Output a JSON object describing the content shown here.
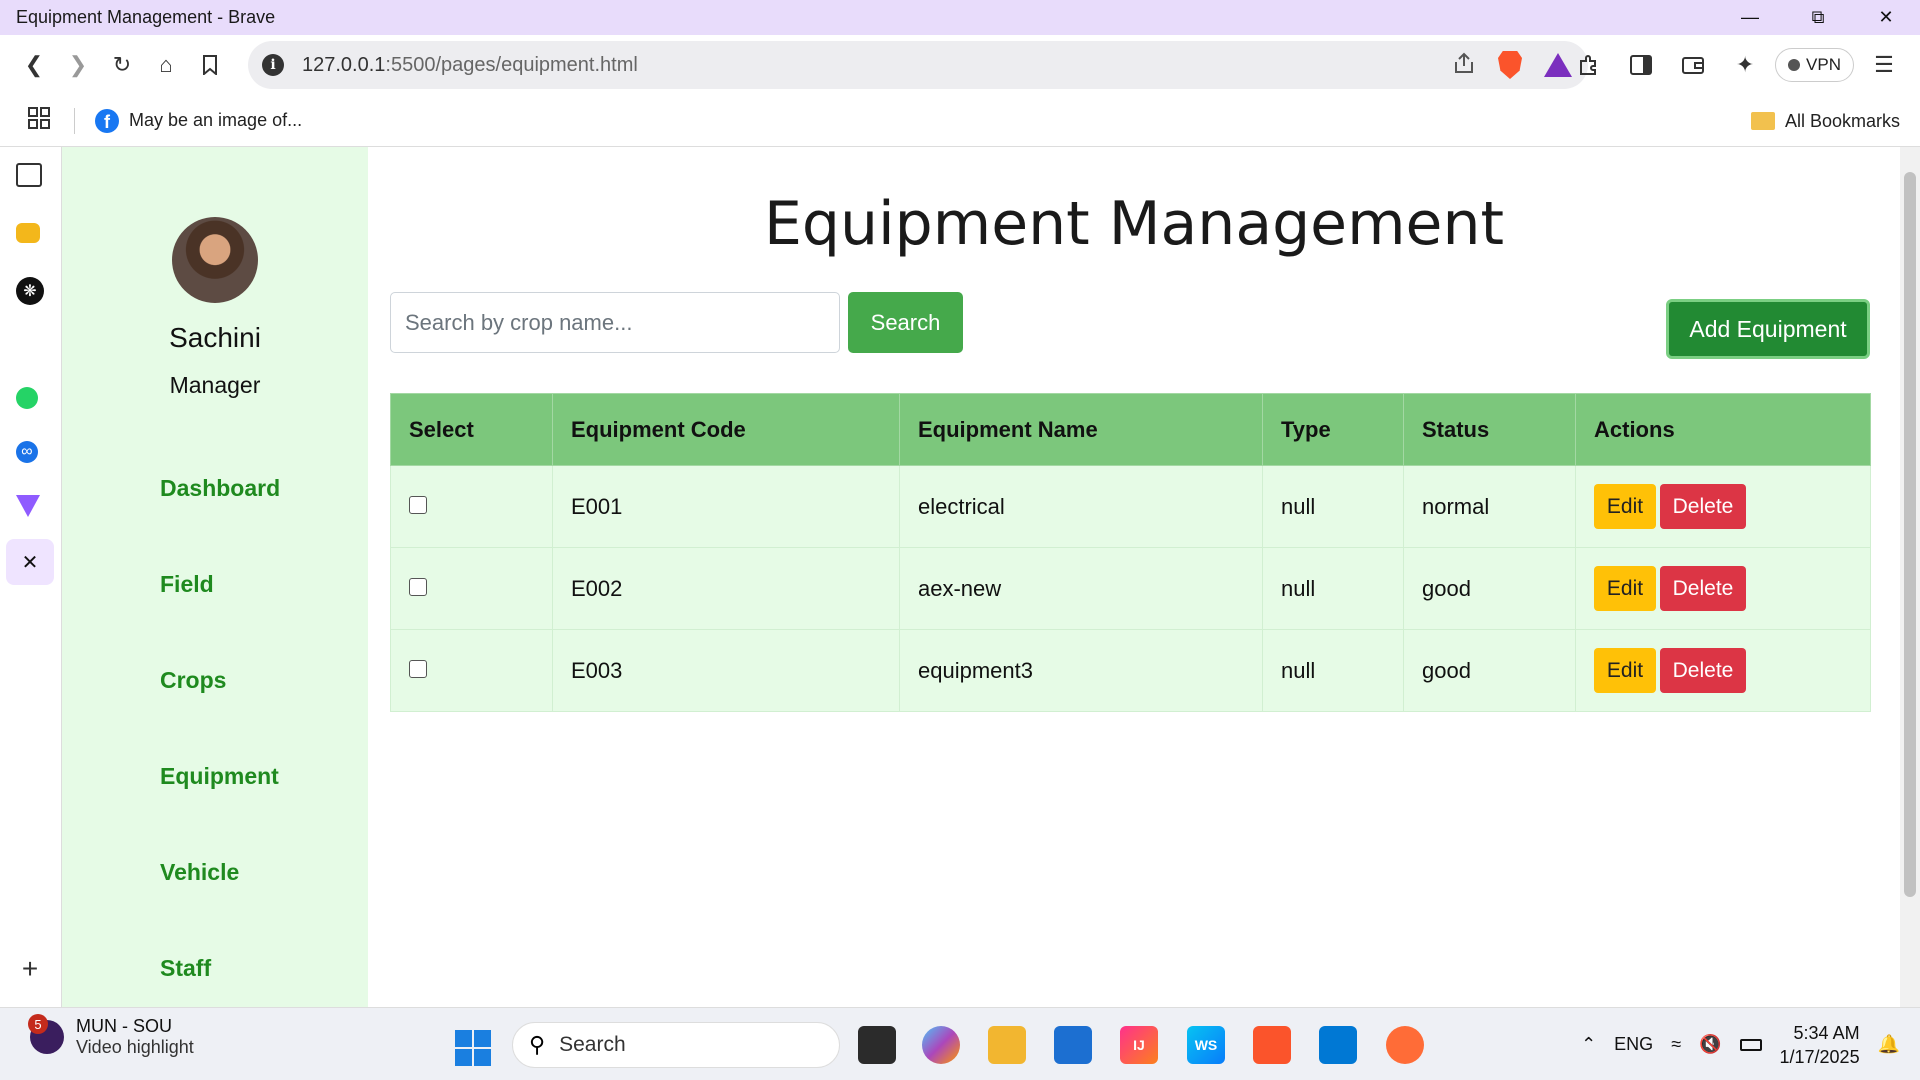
{
  "window": {
    "title": "Equipment Management - Brave"
  },
  "browser": {
    "url_host": "127.0.0.1",
    "url_path": ":5500/pages/equipment.html",
    "vpn_label": "VPN",
    "bookmark_label": "May be an image of...",
    "all_bookmarks_label": "All Bookmarks"
  },
  "sidebar": {
    "user_name": "Sachini",
    "user_role": "Manager",
    "nav": [
      "Dashboard",
      "Field",
      "Crops",
      "Equipment",
      "Vehicle",
      "Staff"
    ]
  },
  "page": {
    "title": "Equipment Management",
    "search_placeholder": "Search by crop name...",
    "search_button": "Search",
    "add_button": "Add Equipment"
  },
  "table": {
    "headers": [
      "Select",
      "Equipment Code",
      "Equipment Name",
      "Type",
      "Status",
      "Actions"
    ],
    "rows": [
      {
        "code": "E001",
        "name": "electrical",
        "type": "null",
        "status": "normal"
      },
      {
        "code": "E002",
        "name": "aex-new",
        "type": "null",
        "status": "good"
      },
      {
        "code": "E003",
        "name": "equipment3",
        "type": "null",
        "status": "good"
      }
    ],
    "edit_label": "Edit",
    "delete_label": "Delete"
  },
  "taskbar": {
    "notif_badge": "5",
    "notif_title": "MUN - SOU",
    "notif_sub": "Video highlight",
    "search_label": "Search",
    "lang": "ENG",
    "time": "5:34 AM",
    "date": "1/17/2025"
  },
  "colors": {
    "accent_green": "#45a94b",
    "sidebar_bg": "#e6fbe6",
    "header_green": "#7cc77c",
    "edit_yellow": "#ffc107",
    "delete_red": "#dc3545"
  }
}
